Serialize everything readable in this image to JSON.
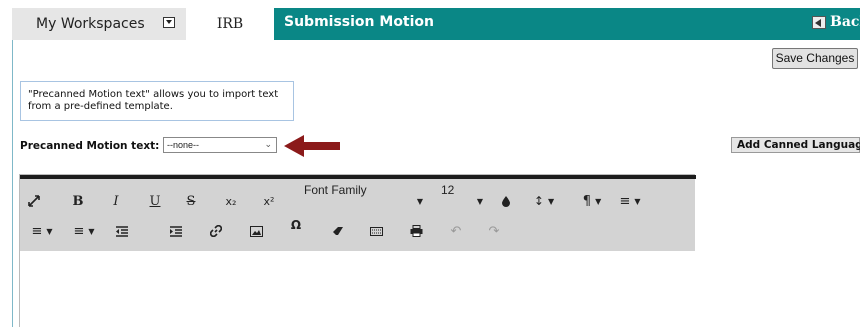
{
  "tabs": {
    "workspaces": "My Workspaces",
    "irb": "IRB",
    "submission_motion": "Submission Motion",
    "back": "Back"
  },
  "actions": {
    "save_changes": "Save Changes",
    "add_canned_language": "Add Canned Language"
  },
  "info": {
    "line1": "\"Precanned Motion text\" allows you to import text",
    "line2": "from a pre-defined template."
  },
  "canned": {
    "label": "Precanned Motion text:",
    "selected": "--none--"
  },
  "toolbar": {
    "bold": "B",
    "italic": "I",
    "underline": "U",
    "strikethrough": "S",
    "subscript": "x₂",
    "superscript": "x²",
    "font_family": "Font Family",
    "font_size": "12",
    "special_char": "Ω"
  },
  "colors": {
    "teal": "#0a8786",
    "arrow": "#8b1a1a",
    "toolbar_bg": "#d3d3d3"
  }
}
